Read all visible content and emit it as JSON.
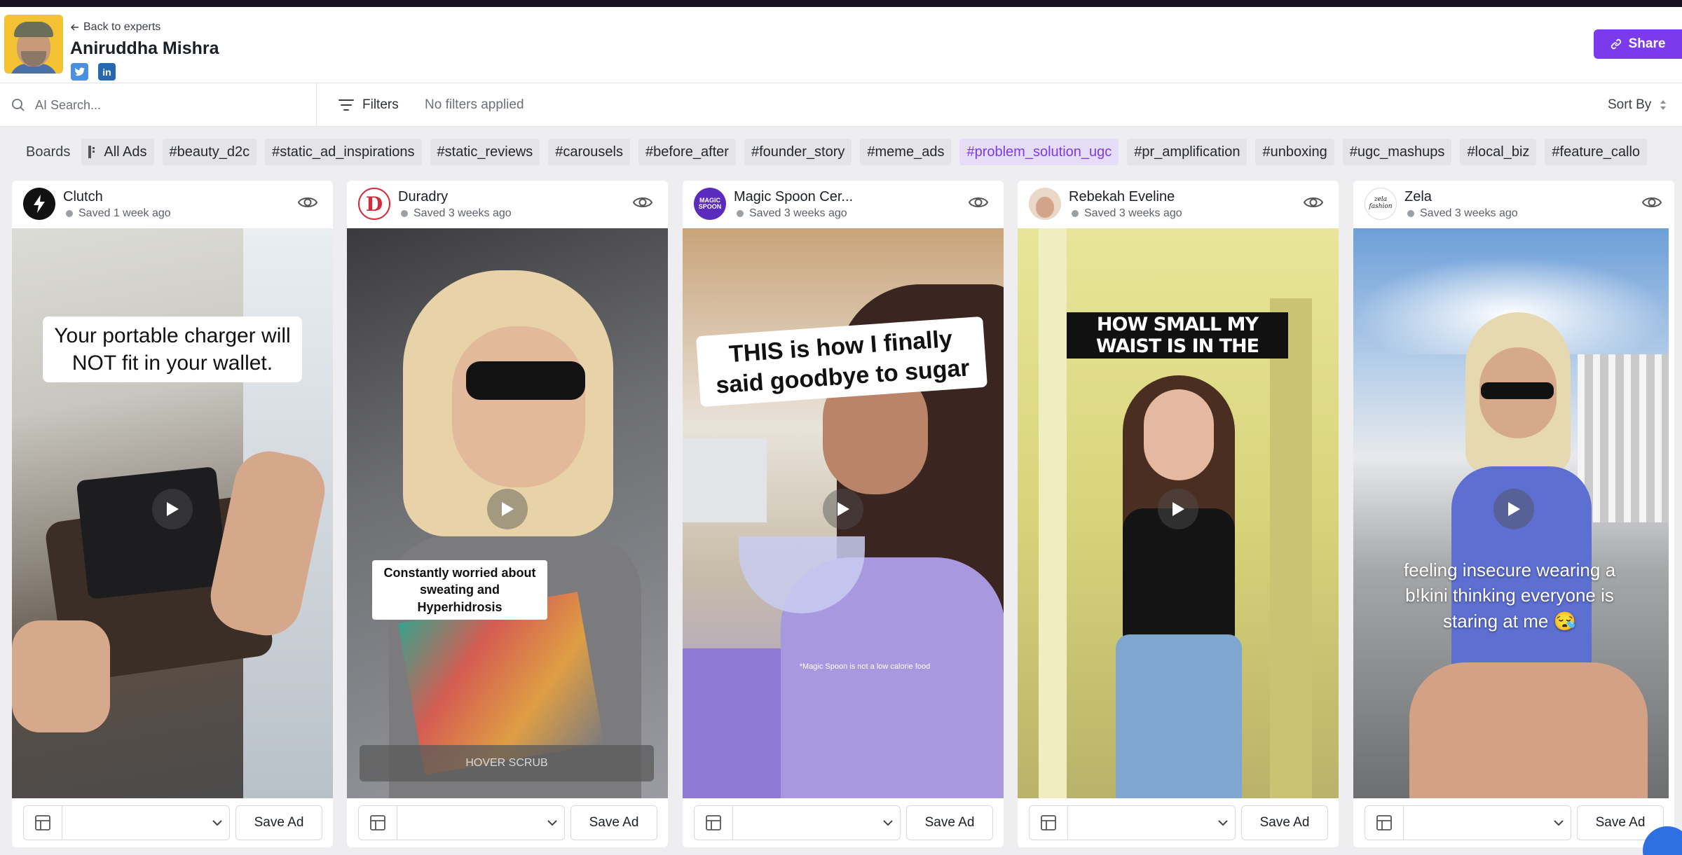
{
  "header": {
    "back_label": "Back to experts",
    "expert_name": "Aniruddha Mishra",
    "twitter_label": "t",
    "linkedin_label": "in",
    "share_label": "Share"
  },
  "toolbar": {
    "search_placeholder": "AI Search...",
    "filters_label": "Filters",
    "filters_status": "No filters applied",
    "sort_label": "Sort By"
  },
  "boards": {
    "label": "Boards",
    "items": [
      {
        "label": "All Ads",
        "active": false
      },
      {
        "label": "#beauty_d2c",
        "active": false
      },
      {
        "label": "#static_ad_inspirations",
        "active": false
      },
      {
        "label": "#static_reviews",
        "active": false
      },
      {
        "label": "#carousels",
        "active": false
      },
      {
        "label": "#before_after",
        "active": false
      },
      {
        "label": "#founder_story",
        "active": false
      },
      {
        "label": "#meme_ads",
        "active": false
      },
      {
        "label": "#problem_solution_ugc",
        "active": true
      },
      {
        "label": "#pr_amplification",
        "active": false
      },
      {
        "label": "#unboxing",
        "active": false
      },
      {
        "label": "#ugc_mashups",
        "active": false
      },
      {
        "label": "#local_biz",
        "active": false
      },
      {
        "label": "#feature_callo",
        "active": false
      }
    ]
  },
  "ads": [
    {
      "brand": "Clutch",
      "saved": "Saved 1 week ago",
      "caption": "Your portable charger will NOT fit in your wallet.",
      "save_label": "Save Ad"
    },
    {
      "brand": "Duradry",
      "saved": "Saved 3 weeks ago",
      "caption": "Constantly worried about sweating and Hyperhidrosis",
      "overlay": "HOVER SCRUB",
      "logo_letter": "D",
      "save_label": "Save Ad"
    },
    {
      "brand": "Magic Spoon Cer...",
      "saved": "Saved 3 weeks ago",
      "caption": "THIS is how I finally said goodbye to sugar",
      "footnote": "*Magic Spoon is not a low calorie food",
      "logo_text": "MAGIC SPOON",
      "save_label": "Save Ad"
    },
    {
      "brand": "Rebekah Eveline",
      "saved": "Saved 3 weeks ago",
      "caption": "HOW SMALL MY WAIST IS IN THE",
      "save_label": "Save Ad"
    },
    {
      "brand": "Zela",
      "saved": "Saved 3 weeks ago",
      "caption": "feeling insecure wearing a b!kini thinking everyone is staring at me 😪",
      "logo_text": "zela fashion",
      "save_label": "Save Ad"
    }
  ],
  "colors": {
    "accent": "#7c3aed",
    "active_chip_bg": "#e6ddf9"
  }
}
